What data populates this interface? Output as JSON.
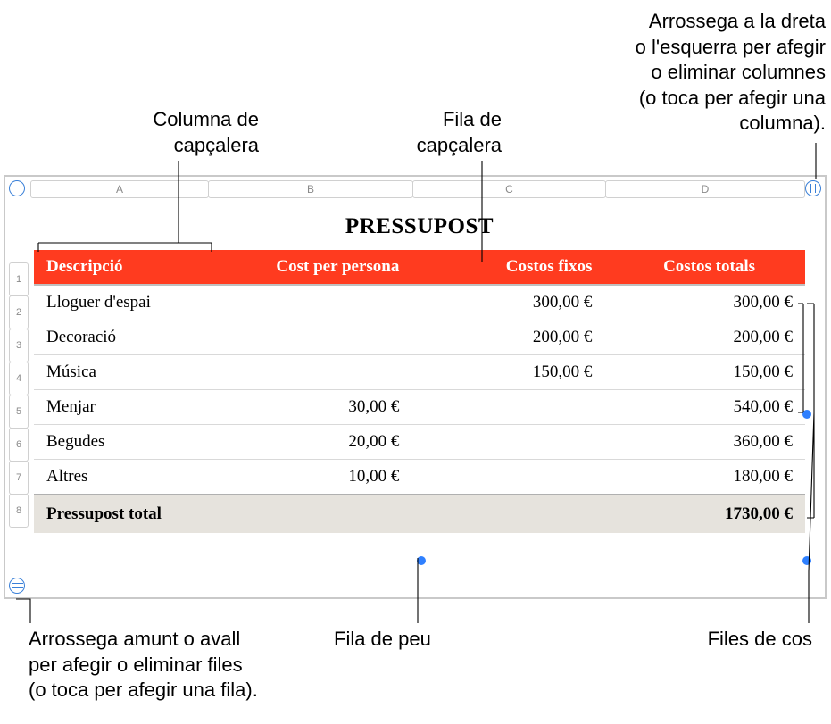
{
  "callouts": {
    "header_col": "Columna de\ncapçalera",
    "header_row": "Fila de\ncapçalera",
    "drag_cols": "Arrossega a la dreta\no l'esquerra per afegir\no eliminar columnes\n(o toca per afegir una\ncolumna).",
    "drag_rows": "Arrossega amunt o avall\nper afegir o eliminar files\n(o toca per afegir una fila).",
    "footer_row": "Fila de peu",
    "body_rows": "Files de cos"
  },
  "columns_letters": [
    "A",
    "B",
    "C",
    "D"
  ],
  "row_numbers": [
    "1",
    "2",
    "3",
    "4",
    "5",
    "6",
    "7",
    "8"
  ],
  "title": "PRESSUPOST",
  "headers": {
    "desc": "Descripció",
    "per_person": "Cost per persona",
    "fixed": "Costos fixos",
    "total": "Costos totals"
  },
  "rows": [
    {
      "desc": "Lloguer d'espai",
      "per_person": "",
      "fixed": "300,00 €",
      "total": "300,00 €"
    },
    {
      "desc": "Decoració",
      "per_person": "",
      "fixed": "200,00 €",
      "total": "200,00 €"
    },
    {
      "desc": "Música",
      "per_person": "",
      "fixed": "150,00 €",
      "total": "150,00 €"
    },
    {
      "desc": "Menjar",
      "per_person": "30,00 €",
      "fixed": "",
      "total": "540,00 €"
    },
    {
      "desc": "Begudes",
      "per_person": "20,00 €",
      "fixed": "",
      "total": "360,00 €"
    },
    {
      "desc": "Altres",
      "per_person": "10,00 €",
      "fixed": "",
      "total": "180,00 €"
    }
  ],
  "footer": {
    "label": "Pressupost total",
    "value": "1730,00 €"
  },
  "colors": {
    "header_bg": "#ff3b1f",
    "accent": "#3a80d8"
  },
  "chart_data": {
    "type": "table",
    "title": "PRESSUPOST",
    "columns": [
      "Descripció",
      "Cost per persona",
      "Costos fixos",
      "Costos totals"
    ],
    "rows": [
      [
        "Lloguer d'espai",
        null,
        300.0,
        300.0
      ],
      [
        "Decoració",
        null,
        200.0,
        200.0
      ],
      [
        "Música",
        null,
        150.0,
        150.0
      ],
      [
        "Menjar",
        30.0,
        null,
        540.0
      ],
      [
        "Begudes",
        20.0,
        null,
        360.0
      ],
      [
        "Altres",
        10.0,
        null,
        180.0
      ]
    ],
    "footer": [
      "Pressupost total",
      null,
      null,
      1730.0
    ],
    "currency": "EUR"
  }
}
